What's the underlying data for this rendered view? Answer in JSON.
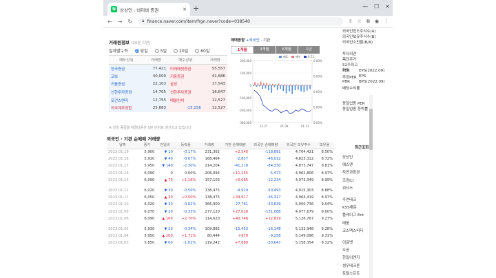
{
  "browser": {
    "tab_title": "상상인 : 네이버 증권",
    "favicon": "N",
    "url": "finance.naver.com/item/frgn.naver?code=038540"
  },
  "broker_section": {
    "title": "거래원정보",
    "subtitle": "(20분 지연)",
    "period_label": "일자별누적",
    "periods": [
      "당일",
      "5일",
      "20일",
      "60일"
    ],
    "selected_period": "당일",
    "headers": [
      "매도상위",
      "거래량",
      "매수상위",
      "거래량"
    ],
    "rows": [
      [
        "한국증권",
        "77,421",
        "미래에셋증권",
        "55,557"
      ],
      [
        "교보",
        "40,000",
        "키움증권",
        "41,686"
      ],
      [
        "키움증권",
        "22,103",
        "삼성",
        "17,543"
      ],
      [
        "신한투자증권",
        "14,705",
        "신한투자증권",
        "16,847"
      ],
      [
        "모건스탠리",
        "12,755",
        "메릴린치",
        "12,527"
      ]
    ],
    "foreign": [
      "외국계추정합",
      "25,683",
      "-13,156",
      "12,527"
    ],
    "note": "※ 당일 종목별 체결내용은 5분 단위로 갱신되고 있습니다"
  },
  "chart_section": {
    "title": "매매동향",
    "link": "+외국인",
    "sep": "·",
    "link2": "기관",
    "tabs": [
      "1개월",
      "3개월",
      "6개월",
      "1년"
    ],
    "selected_tab": "1개월",
    "legend": [
      "매도",
      "매수",
      "0.71"
    ],
    "chart_data": {
      "type": "bar",
      "ylim": [
        -300000,
        200000
      ],
      "left_ticks": [
        "200,000",
        "100,000",
        "0",
        "-100,000",
        "-200,000",
        "-300,000"
      ],
      "right_ticks": [
        "0.00%",
        "0.00%",
        "0.00%",
        "0.00%",
        "0.00%"
      ],
      "x_ticks": [
        "12.27",
        "01.09",
        "01.11"
      ],
      "series": [
        {
          "name": "매도",
          "values": [
            -5000,
            -12000,
            -8000,
            -30000,
            -25000,
            -40000,
            -60000,
            -15000,
            -38000,
            -28000,
            -45000,
            -65000,
            -50000,
            -70000,
            -40000,
            -35000,
            -48000,
            -55000,
            -42000,
            -30000
          ]
        },
        {
          "name": "매수",
          "values": [
            25000,
            15000,
            30000,
            18000,
            20000,
            10000,
            12000,
            8000,
            14000,
            6000,
            9000,
            5000,
            7000,
            4000,
            6000,
            3000,
            5000,
            4000,
            2000,
            3000
          ]
        }
      ],
      "line": [
        -40000,
        -60000,
        -90000,
        -160000,
        -180000,
        -200000,
        -210000,
        -190000,
        -200000,
        -220000,
        -210000,
        -200000,
        -230000,
        -220000,
        -200000,
        -210000,
        -190000,
        -200000,
        -215000,
        -205000
      ]
    }
  },
  "trading": {
    "title_red": "외국인 · 기관",
    "title_rest": "순매매 거래량",
    "headers": [
      "날짜",
      "종가",
      "전일비",
      "등락률",
      "거래량",
      "기관 순매매량",
      "외국인 순매매량",
      "외국인 보유주수",
      "보유율"
    ],
    "groups": [
      [
        [
          "2023.01.19",
          "5,900",
          "▼ 10",
          "-0.17%",
          "231,362",
          "+2,540",
          "-118,891",
          "4,704,421",
          "8.50%"
        ],
        [
          "2023.01.18",
          "5,910",
          "▼ 40",
          "-0.67%",
          "168,464",
          "-2,837",
          "-46,012",
          "4,823,312",
          "8.72%"
        ],
        [
          "2023.01.17",
          "5,950",
          "▼ 140",
          "-2.30%",
          "214,204",
          "-41,218",
          "-84,330",
          "4,873,747",
          "8.81%"
        ],
        [
          "2023.01.16",
          "6,090",
          "0",
          "0.00%",
          "206,094",
          "+11,255",
          "-5,473",
          "4,962,806",
          "8.97%"
        ],
        [
          "2023.01.13",
          "6,090",
          "▲ 70",
          "+1.16%",
          "157,103",
          "+5,065",
          "-12,234",
          "4,973,049",
          "8.99%"
        ]
      ],
      [
        [
          "2023.01.12",
          "6,020",
          "▼ 30",
          "-0.50%",
          "138,475",
          "-9,929",
          "-50,493",
          "4,915,303",
          "8.88%"
        ],
        [
          "2023.01.11",
          "6,050",
          "▲ 30",
          "+0.50%",
          "138,475",
          "+34,917",
          "-36,317",
          "4,964,419",
          "8.97%"
        ],
        [
          "2023.01.10",
          "6,020",
          "▼ 30",
          "-0.82%",
          "366,900",
          "-27,761",
          "-43,639",
          "5,000,736",
          "9.04%"
        ],
        [
          "2023.01.09",
          "6,070",
          "▼ 20",
          "-0.33%",
          "277,120",
          "+27,028",
          "-151,088",
          "4,977,679",
          "9.00%"
        ],
        [
          "2023.01.06",
          "6,090",
          "▲ 160",
          "+2.70%",
          "114,620",
          "+40,746",
          "+12,819",
          "5,128,767",
          "9.27%"
        ]
      ],
      [
        [
          "2023.01.05",
          "5,930",
          "▼ 20",
          "-0.34%",
          "109,882",
          "-15,453",
          "-16,148",
          "5,133,948",
          "9.28%"
        ],
        [
          "2023.01.04",
          "5,950",
          "▲ 100",
          "+1.71%",
          "80,444",
          "+970",
          "-9,258",
          "5,149,096",
          "9.31%"
        ],
        [
          "2023.01.03",
          "5,850",
          "▼ 60",
          "-1.02%",
          "119,242",
          "+7,880",
          "-30,647",
          "5,158,354",
          "9.32%"
        ]
      ]
    ]
  },
  "right_info": {
    "top": [
      "외국인한도주식수(A)",
      "외국인보유주식수(B)",
      "외국인소진율(B/A)"
    ],
    "mid": [
      "투자의견",
      "목표주가",
      "52주최고",
      "최저"
    ],
    "per": [
      "PER",
      "EPS(2022.09)",
      "추정PER",
      "EPS",
      "PBR",
      "BPS(2022.09)",
      "배당수익률"
    ],
    "same": [
      "동일업종 PER",
      "동일업종 등락률"
    ],
    "recent_title": "최근조회",
    "recent": [
      "상상인",
      "에스엔",
      "자연과환경",
      "조광ILI",
      "위닉스",
      "주연테크",
      "KSS해운",
      "플레이그 Ent",
      "태웅",
      "코스맥스비티",
      "이글벳",
      "오공",
      "한일이앤지",
      "생우테크론",
      "토탈소프트"
    ]
  }
}
